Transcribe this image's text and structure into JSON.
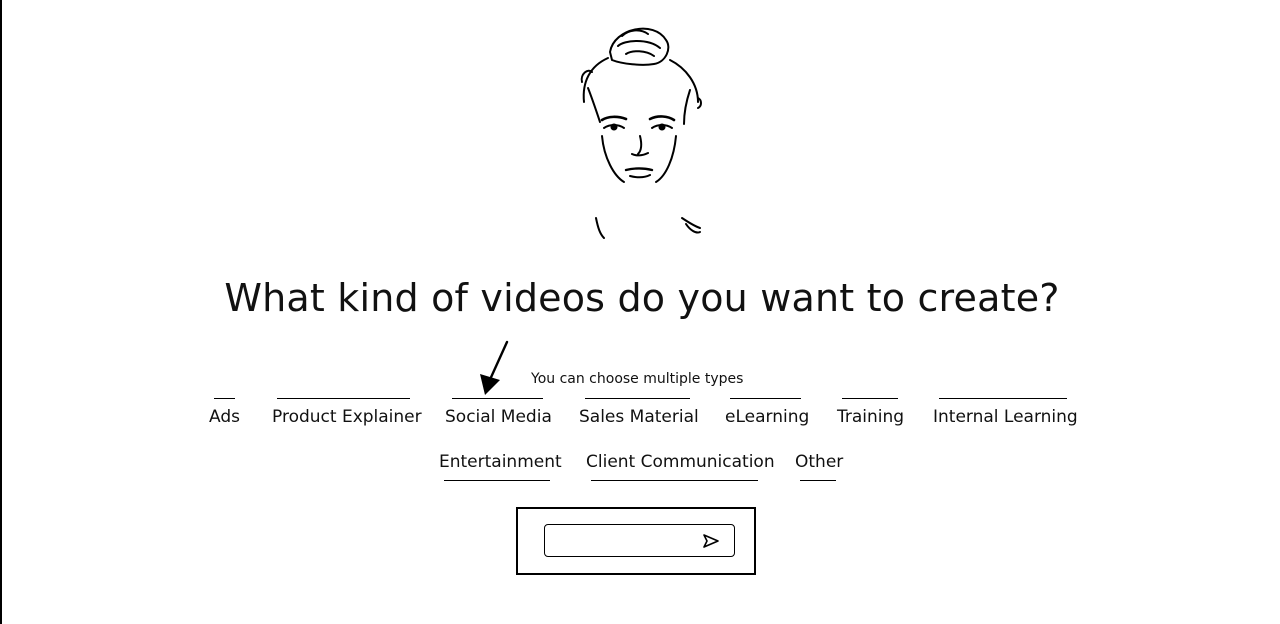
{
  "heading": "What kind of videos do you want to create?",
  "hint": "You can choose multiple types",
  "options_row1": [
    "Ads",
    "Product Explainer",
    "Social Media",
    "Sales Material",
    "eLearning",
    "Training",
    "Internal Learning"
  ],
  "options_row2": [
    "Entertainment",
    "Client Communication",
    "Other"
  ],
  "continue_button": {
    "label": "",
    "icon": "send-arrow-icon"
  },
  "avatar": {
    "icon": "woman-portrait-avatar"
  }
}
